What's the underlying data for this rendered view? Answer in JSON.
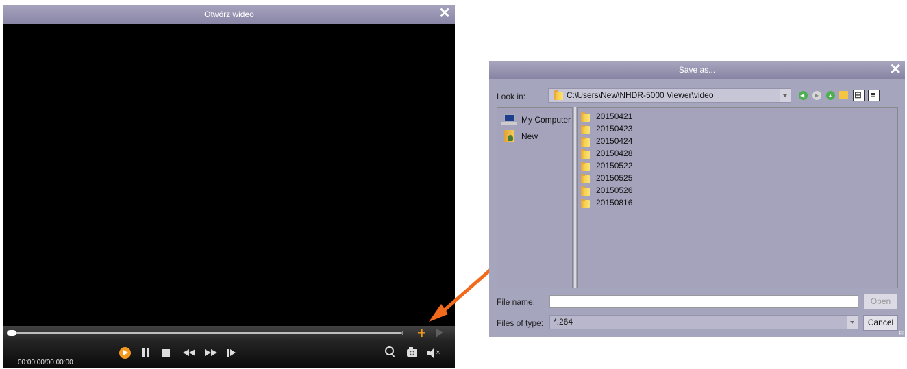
{
  "player": {
    "title": "Otwórz wideo",
    "close_icon": "close-icon",
    "time": "00:00:00/00:00:00",
    "controls": [
      "play-icon",
      "pause-icon",
      "stop-icon",
      "rewind-icon",
      "fast-forward-icon",
      "step-forward-icon",
      "zoom-icon",
      "camera-icon",
      "mute-icon"
    ],
    "add_label": "+",
    "seek_position": 0,
    "accent_color": "#f39a1e"
  },
  "dialog": {
    "title": "Save as...",
    "look_in_label": "Look in:",
    "look_in_path": "C:\\Users\\New\\NHDR-5000 Viewer\\video",
    "places": [
      {
        "label": "My Computer",
        "icon": "computer-icon"
      },
      {
        "label": "New",
        "icon": "user-folder-icon"
      }
    ],
    "files": [
      "20150421",
      "20150423",
      "20150424",
      "20150428",
      "20150522",
      "20150525",
      "20150526",
      "20150816"
    ],
    "file_name_label": "File name:",
    "file_name_value": "",
    "files_of_type_label": "Files of type:",
    "files_of_type_value": "*.264",
    "open_button": "Open",
    "cancel_button": "Cancel"
  },
  "annotation": {
    "arrow_color": "#f26a1b"
  }
}
